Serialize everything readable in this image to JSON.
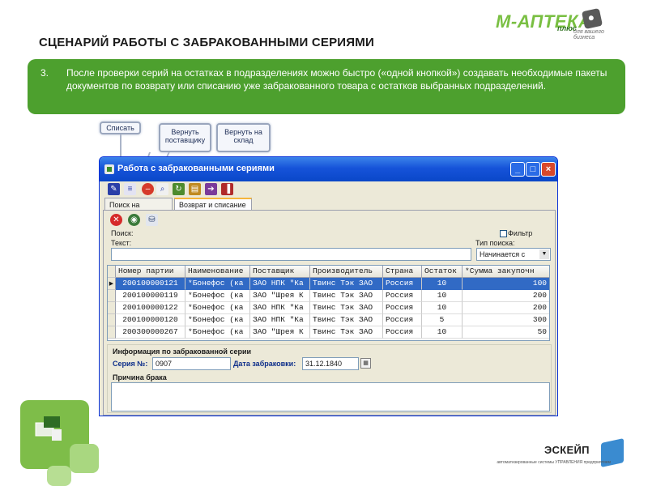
{
  "slide": {
    "logo": {
      "main": "М-АПТЕКА",
      "plus": "плюс",
      "tagline": "для вашего бизнеса"
    },
    "title": "СЦЕНАРИЙ РАБОТЫ С ЗАБРАКОВАННЫМИ СЕРИЯМИ",
    "item_number": "3.",
    "item_text": "После проверки серий на остатках в подразделениях можно быстро («одной кнопкой») создавать необходимые пакеты документов по возврату или списанию уже забракованного товара с остатков выбранных подразделений.",
    "callouts": {
      "write_off": "Списать",
      "return_supplier": "Вернуть поставщику",
      "return_warehouse": "Вернуть на склад"
    },
    "footer": {
      "brand": "ЭСКЕЙП",
      "subtitle": "автоматизированные системы УПРАВЛЕНИЯ предприятием"
    }
  },
  "window": {
    "title": "Работа с забракованными сериями",
    "controls": {
      "minimize": "_",
      "maximize": "□",
      "close": "×"
    },
    "tabs": [
      {
        "label": "Поиск на остатках"
      },
      {
        "label": "Возврат и списание"
      }
    ],
    "search": {
      "group_label": "Поиск:",
      "text_label": "Текст:",
      "text_value": "",
      "filter_label": "Фильтр",
      "type_label": "Тип поиска:",
      "type_value": "Начинается с"
    },
    "table": {
      "columns": [
        "Номер партии",
        "Наименование",
        "Поставщик",
        "Производитель",
        "Страна",
        "Остаток",
        "*Сумма закупочн"
      ],
      "rows": [
        [
          "200100000121",
          "*Бонефос (ка",
          "ЗАО НПК \"Ка",
          "Твинс Тэк ЗАО",
          "Россия",
          "10",
          "100"
        ],
        [
          "200100000119",
          "*Бонефос (ка",
          "ЗАО \"Шрея К",
          "Твинс Тэк ЗАО",
          "Россия",
          "10",
          "200"
        ],
        [
          "200100000122",
          "*Бонефос (ка",
          "ЗАО НПК \"Ка",
          "Твинс Тэк ЗАО",
          "Россия",
          "10",
          "200"
        ],
        [
          "200100000120",
          "*Бонефос (ка",
          "ЗАО НПК \"Ка",
          "Твинс Тэк ЗАО",
          "Россия",
          "5",
          "300"
        ],
        [
          "200300000267",
          "*Бонефос (ка",
          "ЗАО \"Шрея К",
          "Твинс Тэк ЗАО",
          "Россия",
          "10",
          "50"
        ]
      ],
      "selected_row": 0
    },
    "info": {
      "group_label": "Информация по забракованной серии",
      "series_label": "Серия №:",
      "series_value": "0907",
      "date_label": "Дата забраковки:",
      "date_value": "31.12.1840",
      "reason_label": "Причина брака",
      "reason_value": ""
    }
  }
}
